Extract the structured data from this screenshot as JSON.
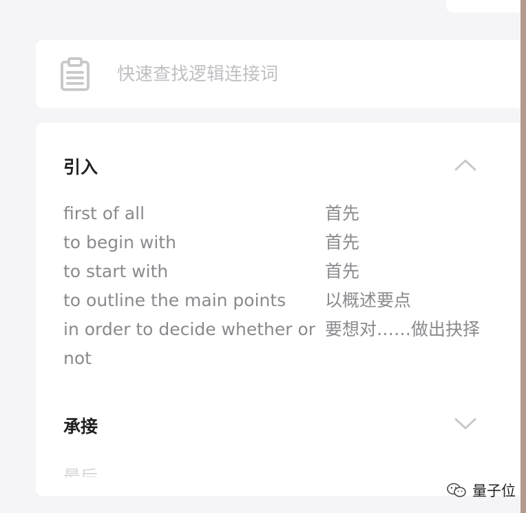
{
  "search": {
    "placeholder": "快速查找逻辑连接词"
  },
  "sections": [
    {
      "title": "引入",
      "expanded": true,
      "rows": [
        {
          "en": "first of all",
          "zh": "首先"
        },
        {
          "en": "to begin with",
          "zh": "首先"
        },
        {
          "en": "to start with",
          "zh": "首先"
        },
        {
          "en": "to outline the main points",
          "zh": "以概述要点"
        },
        {
          "en": "in order to decide whether or",
          "en2": "not",
          "zh": "要想对……做出抉择"
        }
      ]
    },
    {
      "title": "承接",
      "expanded": false,
      "partial_text": "最后"
    }
  ],
  "watermark": {
    "text": "量子位"
  },
  "colors": {
    "background": "#f5f5f7",
    "card": "#ffffff",
    "muted_text": "#8a8a8e",
    "edge": "#b39a8f"
  }
}
